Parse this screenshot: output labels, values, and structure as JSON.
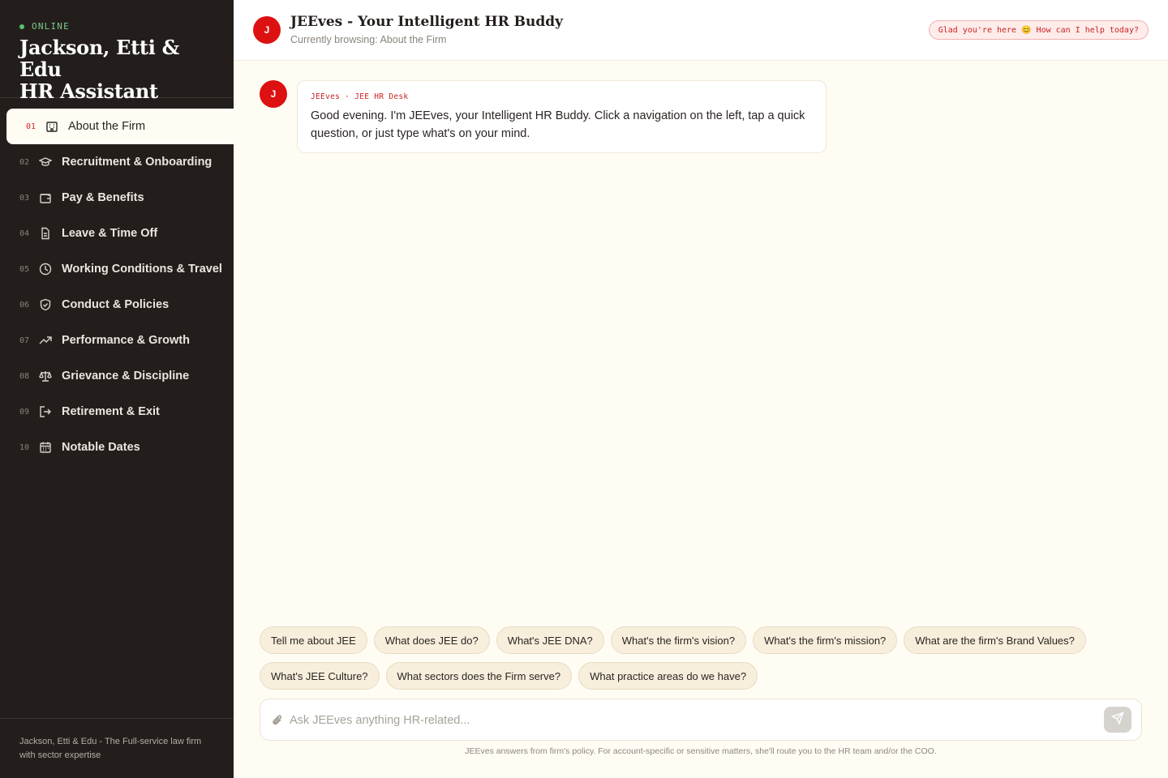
{
  "sidebar": {
    "status": "ONLINE",
    "brand_line1": "Jackson, Etti & Edu",
    "brand_line2": "HR Assistant",
    "items": [
      {
        "num": "01",
        "label": "About the Firm",
        "icon": "building-icon",
        "active": true
      },
      {
        "num": "02",
        "label": "Recruitment & Onboarding",
        "icon": "graduation-cap-icon"
      },
      {
        "num": "03",
        "label": "Pay & Benefits",
        "icon": "wallet-icon"
      },
      {
        "num": "04",
        "label": "Leave & Time Off",
        "icon": "document-icon"
      },
      {
        "num": "05",
        "label": "Working Conditions & Travel",
        "icon": "clock-icon"
      },
      {
        "num": "06",
        "label": "Conduct & Policies",
        "icon": "shield-icon"
      },
      {
        "num": "07",
        "label": "Performance & Growth",
        "icon": "trend-up-icon"
      },
      {
        "num": "08",
        "label": "Grievance & Discipline",
        "icon": "scales-icon"
      },
      {
        "num": "09",
        "label": "Retirement & Exit",
        "icon": "exit-icon"
      },
      {
        "num": "10",
        "label": "Notable Dates",
        "icon": "calendar-icon"
      }
    ],
    "footer_line1": "Jackson, Etti & Edu - The Full-service law firm",
    "footer_line2": "with sector expertise"
  },
  "header": {
    "avatar_letter": "J",
    "title": "JEEves - Your Intelligent HR Buddy",
    "subtitle": "Currently browsing: About the Firm",
    "greeting": "Glad you're here 😊 How can I help today?"
  },
  "message": {
    "avatar_letter": "J",
    "meta": "JEEves · JEE HR Desk",
    "text": "Good evening. I'm JEEves, your Intelligent HR Buddy. Click a navigation on the left, tap a quick question, or just type what's on your mind."
  },
  "chips": [
    "Tell me about JEE",
    "What does JEE do?",
    "What's JEE DNA?",
    "What's the firm's vision?",
    "What's the firm's mission?",
    "What are the firm's Brand Values?",
    "What's JEE Culture?",
    "What sectors does the Firm serve?",
    "What practice areas do we have?"
  ],
  "composer": {
    "placeholder": "Ask JEEves anything HR-related...",
    "value": ""
  },
  "disclaimer": "JEEves answers from firm's policy. For account-specific or sensitive matters, she'll route you to the HR team and/or the COO.",
  "colors": {
    "accent_red": "#dd1111",
    "sidebar_bg": "#231e1c",
    "page_bg": "#fffcf3",
    "online_green": "#5fbf73"
  }
}
